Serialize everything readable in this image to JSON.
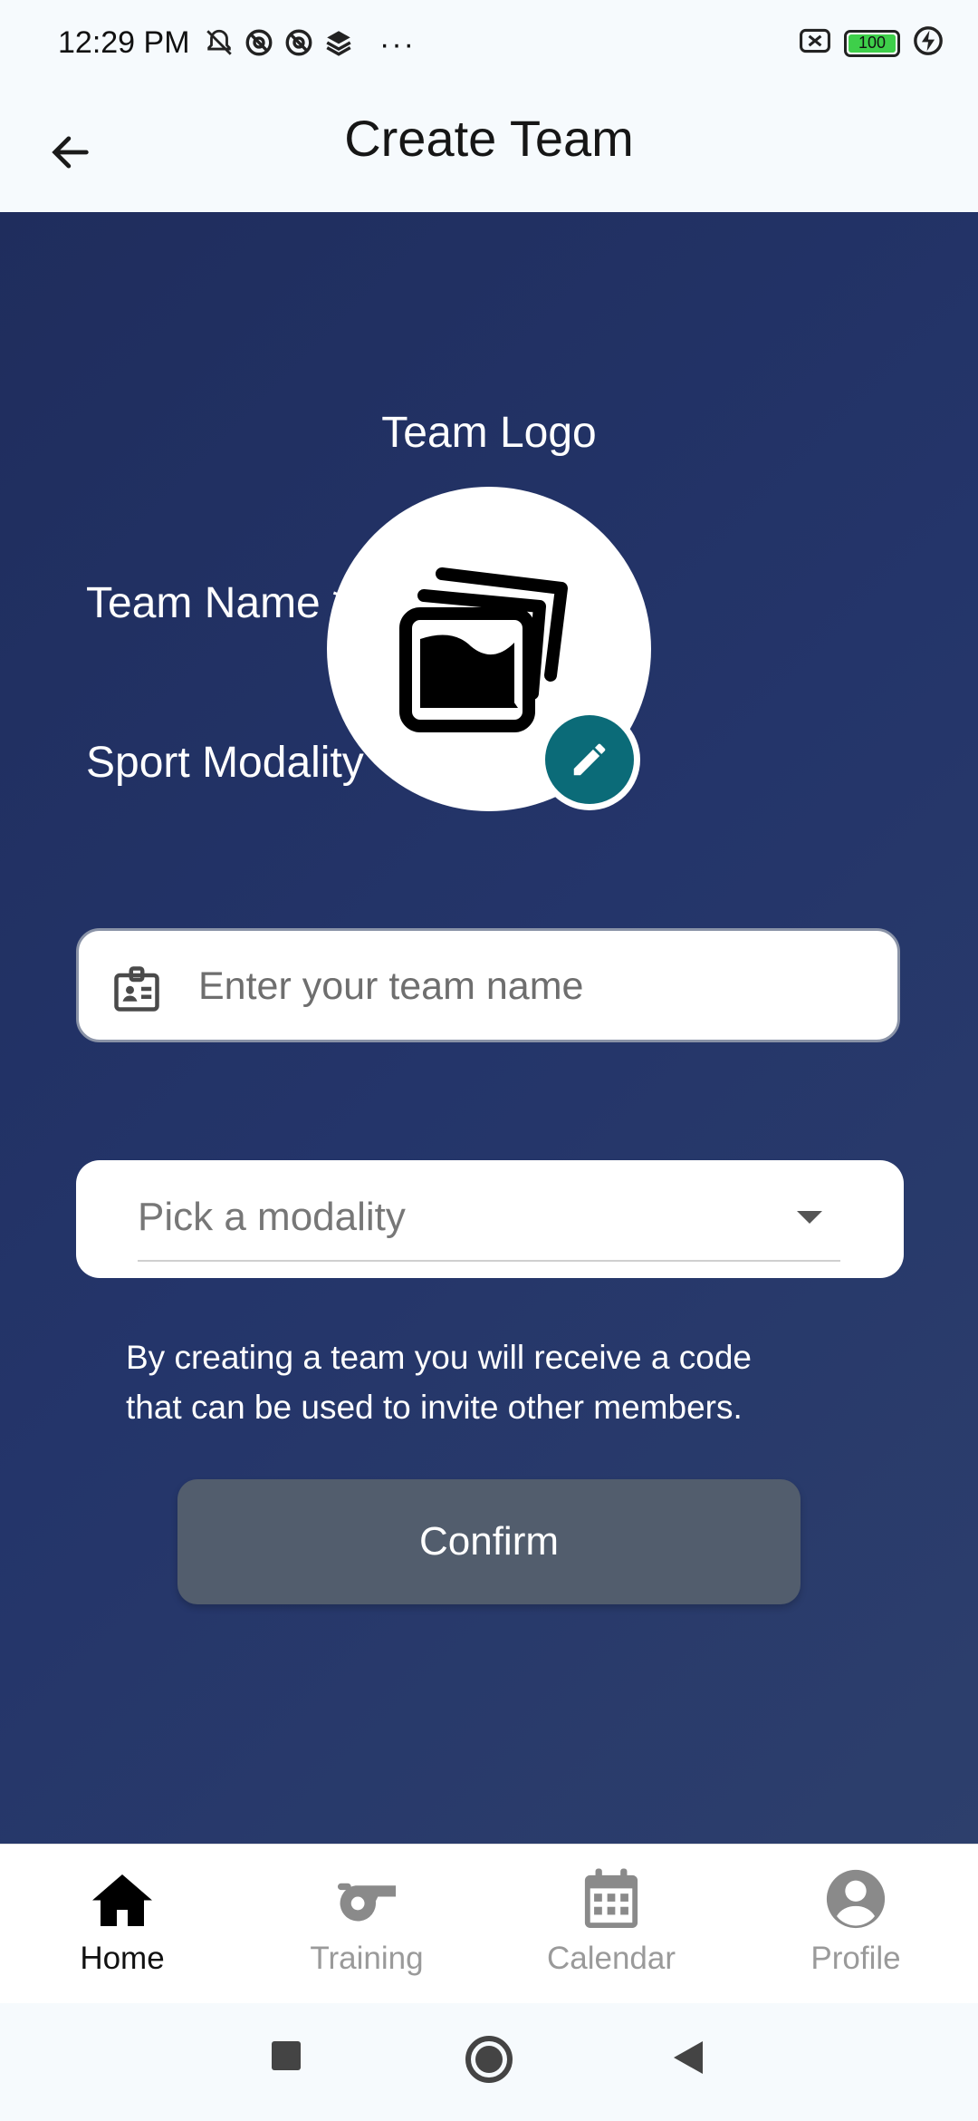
{
  "status_bar": {
    "time": "12:29 PM",
    "more": "···",
    "battery_level": "100",
    "icons": [
      "mute-icon",
      "at-icon",
      "at-icon",
      "layers-icon",
      "close-box-icon",
      "battery-icon",
      "charging-icon"
    ]
  },
  "app_bar": {
    "title": "Create Team",
    "back_icon": "arrow-left-icon"
  },
  "form": {
    "logo_label": "Team Logo",
    "logo_icon": "image-placeholder-icon",
    "edit_icon": "pencil-icon",
    "name_label": "Team Name *",
    "name_placeholder": "Enter your team name",
    "name_value": "",
    "modality_label": "Sport Modality *",
    "modality_placeholder": "Pick a modality",
    "info_line1": "By creating a team you will receive a code",
    "info_line2": "that can be used to invite other members.",
    "confirm_label": "Confirm"
  },
  "bottom_nav": {
    "items": [
      {
        "label": "Home",
        "icon": "home-icon",
        "active": true
      },
      {
        "label": "Training",
        "icon": "whistle-icon",
        "active": false
      },
      {
        "label": "Calendar",
        "icon": "calendar-icon",
        "active": false
      },
      {
        "label": "Profile",
        "icon": "profile-icon",
        "active": false
      }
    ]
  },
  "colors": {
    "background_gradient_start": "#1f2d5d",
    "background_gradient_end": "#2d3f6c",
    "edit_button": "#0b6b78",
    "confirm_button": "#525d6d",
    "battery": "#3ecf4a"
  }
}
